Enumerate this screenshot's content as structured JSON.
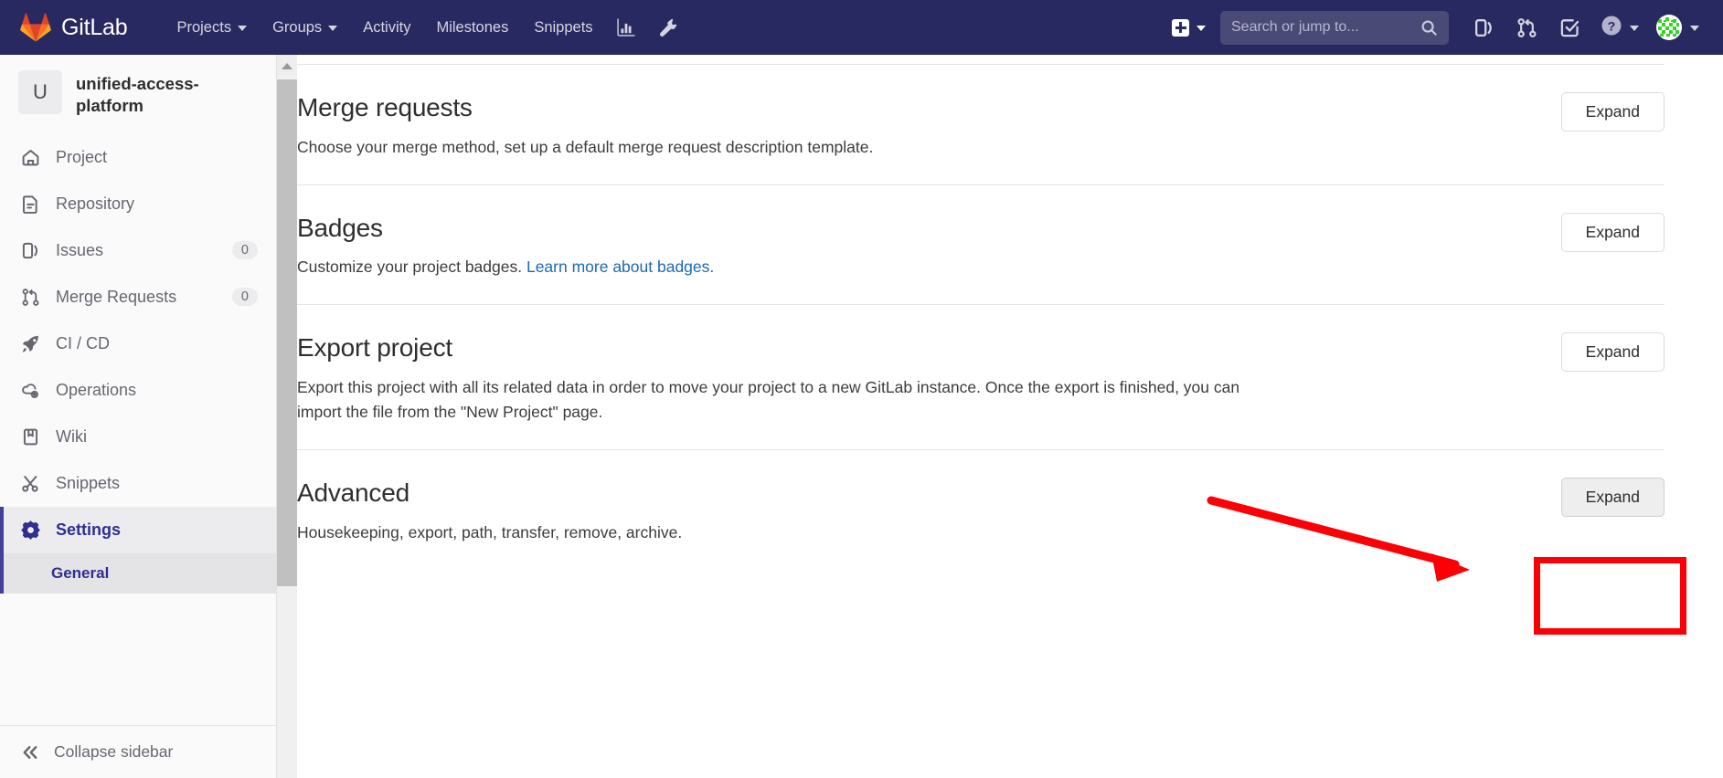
{
  "navbar": {
    "brand": "GitLab",
    "logo_icon": "gitlab-tanuki-icon",
    "links": [
      {
        "label": "Projects",
        "icon": "chevron-down-icon",
        "has_caret": true
      },
      {
        "label": "Groups",
        "icon": "chevron-down-icon",
        "has_caret": true
      },
      {
        "label": "Activity",
        "has_caret": false
      },
      {
        "label": "Milestones",
        "has_caret": false
      },
      {
        "label": "Snippets",
        "has_caret": false
      }
    ],
    "icon_buttons": [
      {
        "name": "analytics-chart-icon"
      },
      {
        "name": "wrench-admin-icon"
      }
    ],
    "create_new": {
      "icon": "plus-square-icon",
      "caret": "chevron-down-icon"
    },
    "search": {
      "placeholder": "Search or jump to...",
      "value": "",
      "icon": "search-icon"
    },
    "right_icons": [
      {
        "name": "issues-icon"
      },
      {
        "name": "merge-requests-icon"
      },
      {
        "name": "todos-checkbox-icon"
      }
    ],
    "help": {
      "icon": "question-circle-icon",
      "caret": "chevron-down-icon"
    },
    "user": {
      "icon": "avatar-identicon",
      "caret": "chevron-down-icon"
    },
    "colors": {
      "background": "#292961",
      "search_bg": "#4a4a77"
    }
  },
  "sidebar": {
    "project": {
      "initial": "U",
      "name": "unified-access-platform"
    },
    "items": [
      {
        "label": "Project",
        "icon": "home-icon",
        "count": ""
      },
      {
        "label": "Repository",
        "icon": "document-icon",
        "count": ""
      },
      {
        "label": "Issues",
        "icon": "issues-icon",
        "count": "0"
      },
      {
        "label": "Merge Requests",
        "icon": "merge-requests-icon",
        "count": "0"
      },
      {
        "label": "CI / CD",
        "icon": "rocket-icon",
        "count": ""
      },
      {
        "label": "Operations",
        "icon": "cloud-gear-icon",
        "count": ""
      },
      {
        "label": "Wiki",
        "icon": "book-icon",
        "count": ""
      },
      {
        "label": "Snippets",
        "icon": "scissors-icon",
        "count": ""
      },
      {
        "label": "Settings",
        "icon": "gear-icon",
        "count": "",
        "active": true
      }
    ],
    "subitem": {
      "label": "General",
      "active": true
    },
    "collapse": {
      "label": "Collapse sidebar",
      "icon": "double-chevron-left-icon"
    }
  },
  "main": {
    "sections": [
      {
        "title": "Merge requests",
        "desc": "Choose your merge method, set up a default merge request description template.",
        "button": "Expand",
        "link_text": "",
        "pressed": false
      },
      {
        "title": "Badges",
        "desc": "Customize your project badges. ",
        "link_text": "Learn more about badges.",
        "button": "Expand",
        "pressed": false
      },
      {
        "title": "Export project",
        "desc": "Export this project with all its related data in order to move your project to a new GitLab instance. Once the export is finished, you can import the file from the \"New Project\" page.",
        "link_text": "",
        "button": "Expand",
        "pressed": false
      },
      {
        "title": "Advanced",
        "desc": "Housekeeping, export, path, transfer, remove, archive.",
        "link_text": "",
        "button": "Expand",
        "pressed": true
      }
    ]
  },
  "annotations": {
    "highlight_color": "#fb0007",
    "target": "advanced-expand-button",
    "arrow": "pointer-arrow-to-expand"
  },
  "scrollbar": {
    "up_arrow": "scroll-up-arrow",
    "thumb": "scroll-thumb"
  }
}
